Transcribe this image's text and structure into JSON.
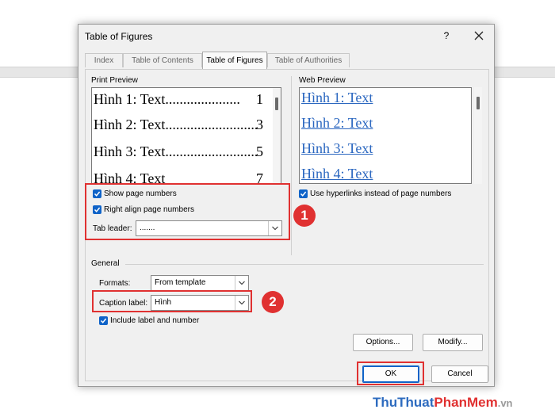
{
  "window": {
    "title": "Table of Figures",
    "help": "?"
  },
  "tabs": [
    {
      "label": "Index",
      "active": false
    },
    {
      "label": "Table of Contents",
      "active": false
    },
    {
      "label": "Table of Figures",
      "active": true
    },
    {
      "label": "Table of Authorities",
      "active": false
    }
  ],
  "print_preview": {
    "label": "Print Preview",
    "entries": [
      {
        "text": "Hình 1: Text",
        "dots": ".....................",
        "page": "1"
      },
      {
        "text": "Hình 2: Text",
        "dots": "..........................",
        "page": "3"
      },
      {
        "text": "Hình 3: Text",
        "dots": "..........................",
        "page": "5"
      },
      {
        "text": "Hình 4: Text",
        "dots": "",
        "page": "7"
      }
    ]
  },
  "web_preview": {
    "label": "Web Preview",
    "entries": [
      "Hình 1: Text",
      "Hình 2: Text",
      "Hình 3: Text",
      "Hình 4: Text"
    ]
  },
  "options": {
    "show_page_numbers": {
      "label": "Show page numbers",
      "checked": true
    },
    "right_align": {
      "label": "Right align page numbers",
      "checked": true
    },
    "tab_leader": {
      "label": "Tab leader:",
      "value": "......."
    },
    "use_hyperlinks": {
      "label": "Use hyperlinks instead of page numbers",
      "checked": true
    }
  },
  "general": {
    "label": "General",
    "formats": {
      "label": "Formats:",
      "value": "From template"
    },
    "caption_label": {
      "label": "Caption label:",
      "value": "Hình"
    },
    "include_label": {
      "label": "Include label and number",
      "checked": true
    }
  },
  "buttons": {
    "options": "Options...",
    "modify": "Modify...",
    "ok": "OK",
    "cancel": "Cancel"
  },
  "annotations": {
    "badge1": "1",
    "badge2": "2",
    "highlight_color": "#e03131"
  },
  "watermark": {
    "part1": "ThuThuat",
    "part2": "PhanMem",
    "part3": ".vn"
  },
  "colors": {
    "accent": "#0f63c8",
    "link": "#2b67c0"
  }
}
